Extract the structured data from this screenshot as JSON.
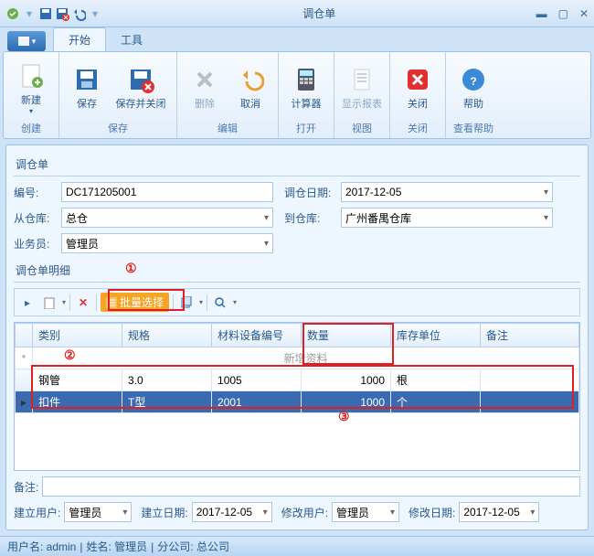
{
  "window": {
    "title": "调仓单"
  },
  "tabs": {
    "start": "开始",
    "tools": "工具"
  },
  "ribbon": {
    "create": {
      "new": "新建",
      "group": "创建"
    },
    "save": {
      "save": "保存",
      "saveclose": "保存并关闭",
      "group": "保存"
    },
    "edit": {
      "delete": "删除",
      "cancel": "取消",
      "group": "编辑"
    },
    "open": {
      "calc": "计算器",
      "group": "打开"
    },
    "view": {
      "report": "显示报表",
      "group": "视图"
    },
    "close": {
      "close": "关闭",
      "group": "关闭"
    },
    "help": {
      "help": "帮助",
      "group": "查看帮助"
    }
  },
  "section": {
    "header": "调仓单",
    "detail": "调仓单明细"
  },
  "form": {
    "numlbl": "编号:",
    "num": "DC171205001",
    "datelbl": "调仓日期:",
    "date": "2017-12-05",
    "fromlbl": "从仓库:",
    "from": "总仓",
    "tolbl": "到仓库:",
    "to": "广州番禺仓库",
    "oplbl": "业务员:",
    "op": "管理员"
  },
  "toolbar": {
    "batch": "批量选择"
  },
  "grid": {
    "cols": {
      "cat": "类别",
      "spec": "规格",
      "code": "材料设备编号",
      "qty": "数量",
      "unit": "库存单位",
      "remark": "备注"
    },
    "newrow": "新增资料",
    "rows": [
      {
        "cat": "钢管",
        "spec": "3.0",
        "code": "1005",
        "qty": "1000",
        "unit": "根",
        "remark": ""
      },
      {
        "cat": "扣件",
        "spec": "T型",
        "code": "2001",
        "qty": "1000",
        "unit": "个",
        "remark": ""
      }
    ]
  },
  "anno": {
    "a1": "①",
    "a2": "②",
    "a3": "③"
  },
  "remark": {
    "lbl": "备注:"
  },
  "footer": {
    "crulbl": "建立用户:",
    "cru": "管理员",
    "crdlbl": "建立日期:",
    "crd": "2017-12-05",
    "mdulbl": "修改用户:",
    "mdu": "管理员",
    "mddlbl": "修改日期:",
    "mdd": "2017-12-05"
  },
  "status": {
    "user": "用户名: admin",
    "name": "姓名: 管理员",
    "branch": "分公司: 总公司",
    "sep": " | "
  }
}
